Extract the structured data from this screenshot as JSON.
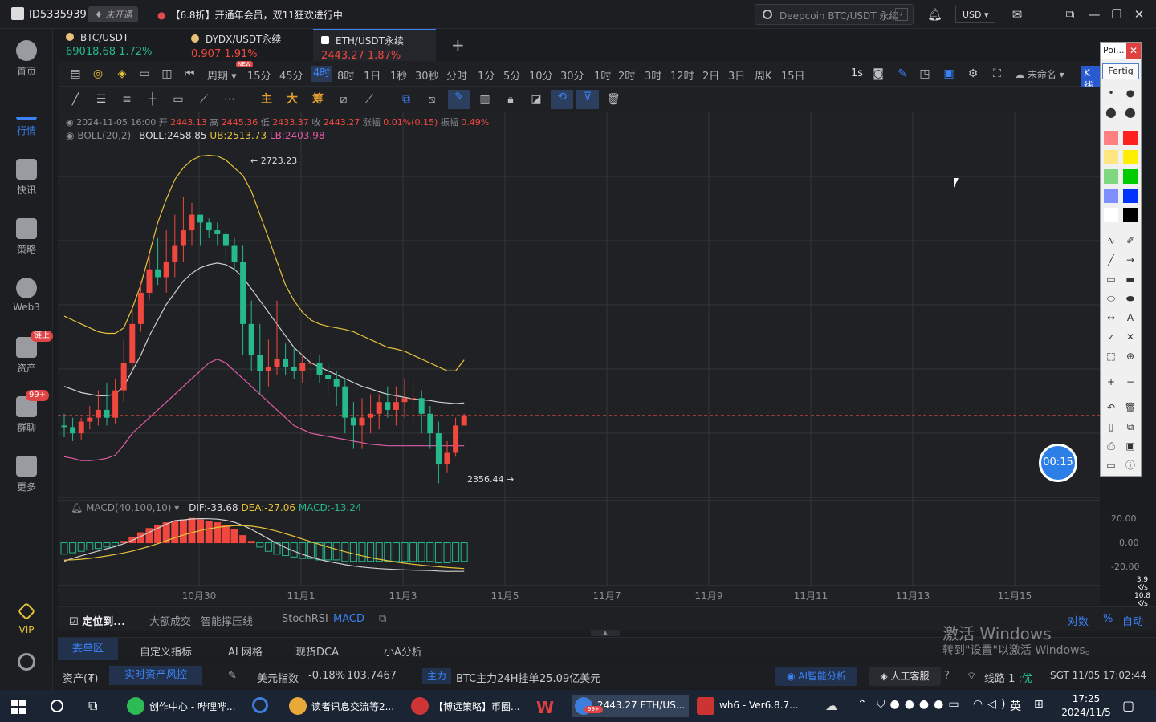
{
  "topbar": {
    "user_id": "ID5335939",
    "vip_status": "未开通",
    "promo": "【6.8折】开通年会员，双11狂欢进行中",
    "search_placeholder": "Deepcoin BTC/USDT 永续",
    "search_shortcut": "/",
    "currency": "USD"
  },
  "sidebar": {
    "items": [
      {
        "label": "首页"
      },
      {
        "label": "行情"
      },
      {
        "label": "快讯"
      },
      {
        "label": "策略"
      },
      {
        "label": "Web3"
      },
      {
        "label": "资产",
        "badge": "链上"
      },
      {
        "label": "群聊",
        "badge": "99+"
      },
      {
        "label": "更多"
      },
      {
        "label": "VIP"
      }
    ]
  },
  "tabs": [
    {
      "symbol": "BTC/USDT",
      "price": "69018.68",
      "change": "1.72%",
      "color": "#26b98c"
    },
    {
      "symbol": "DYDX/USDT永续",
      "price": "0.907",
      "change": "1.91%",
      "color": "#f0483e"
    },
    {
      "symbol": "ETH/USDT永续",
      "price": "2443.27",
      "change": "1.87%",
      "color": "#f0483e"
    }
  ],
  "timeframes": {
    "period_label": "周期",
    "new_badge": "NEW",
    "items": [
      "15分",
      "45分",
      "4时",
      "8时",
      "1日",
      "1秒",
      "30秒",
      "分时",
      "1分",
      "5分",
      "10分",
      "30分",
      "1时",
      "2时",
      "3时",
      "12时",
      "2日",
      "3日",
      "周K",
      "15日"
    ],
    "active": "4时",
    "right_interval": "1s",
    "layout_name": "未命名",
    "kline_label": "K线"
  },
  "tools": {
    "labels": [
      "主",
      "大",
      "筹"
    ]
  },
  "chart_info": {
    "date": "2024-11-05 16:00",
    "open_label": "开",
    "open": "2443.13",
    "high_label": "高",
    "high": "2445.36",
    "low_label": "低",
    "low": "2433.37",
    "close_label": "收",
    "close": "2443.27",
    "change_label": "涨幅",
    "change": "0.01%(0.15)",
    "amp_label": "振幅",
    "amp": "0.49%",
    "boll_name": "BOLL(20,2)",
    "boll": "BOLL:2458.85",
    "ub": "UB:2513.73",
    "lb": "LB:2403.98",
    "high_marker": "2723.23",
    "low_marker": "2356.44",
    "macd_name": "MACD(40,100,10)",
    "dif": "DIF:-33.68",
    "dea": "DEA:-27.06",
    "macd": "MACD:-13.24",
    "timer": "00:15",
    "macd_axis": [
      "20.00",
      "0.00",
      "-20.00"
    ],
    "speed_up": "3.9",
    "speed_up_unit": "K/s",
    "speed_down": "10.8",
    "speed_down_unit": "K/s",
    "x_labels": [
      "10月30",
      "11月1",
      "11月3",
      "11月5",
      "11月7",
      "11月9",
      "11月11",
      "11月13",
      "11月15",
      "11月"
    ]
  },
  "chart_data": {
    "type": "candlestick",
    "x": [
      "10月28 20:00",
      "10月29 00:00",
      "10月29 04:00",
      "10月29 08:00",
      "10月29 12:00",
      "10月29 16:00",
      "10月29 20:00",
      "10月30 00:00",
      "10月30 04:00",
      "10月30 08:00",
      "10月30 12:00",
      "10月30 16:00",
      "10月30 20:00",
      "10月31 00:00",
      "10月31 04:00",
      "10月31 08:00",
      "10月31 12:00",
      "10月31 16:00",
      "10月31 20:00",
      "11月1 00:00",
      "11月1 04:00",
      "11月1 08:00",
      "11月1 12:00",
      "11月1 16:00",
      "11月1 20:00",
      "11月2 00:00",
      "11月2 04:00",
      "11月2 08:00",
      "11月2 12:00",
      "11月2 16:00",
      "11月2 20:00",
      "11月3 00:00",
      "11月3 04:00",
      "11月3 08:00",
      "11月3 12:00",
      "11月3 16:00",
      "11月3 20:00",
      "11月4 00:00",
      "11月4 04:00",
      "11月4 08:00",
      "11月4 12:00",
      "11月4 16:00",
      "11月4 20:00",
      "11月5 00:00",
      "11月5 04:00",
      "11月5 08:00",
      "11月5 12:00",
      "11月5 16:00"
    ],
    "open": [
      2430,
      2428,
      2420,
      2435,
      2440,
      2450,
      2440,
      2475,
      2510,
      2560,
      2600,
      2630,
      2620,
      2640,
      2660,
      2680,
      2700,
      2690,
      2680,
      2675,
      2660,
      2640,
      2560,
      2520,
      2500,
      2505,
      2515,
      2505,
      2500,
      2510,
      2510,
      2495,
      2490,
      2480,
      2440,
      2430,
      2440,
      2445,
      2460,
      2450,
      2460,
      2465,
      2465,
      2445,
      2420,
      2380,
      2395,
      2430
    ],
    "high": [
      2445,
      2440,
      2440,
      2455,
      2475,
      2485,
      2490,
      2540,
      2580,
      2615,
      2650,
      2670,
      2680,
      2700,
      2723,
      2715,
      2700,
      2695,
      2690,
      2680,
      2670,
      2660,
      2590,
      2560,
      2540,
      2590,
      2535,
      2530,
      2520,
      2525,
      2520,
      2510,
      2500,
      2490,
      2460,
      2465,
      2470,
      2470,
      2480,
      2480,
      2490,
      2490,
      2475,
      2455,
      2435,
      2410,
      2440,
      2445
    ],
    "low": [
      2415,
      2410,
      2412,
      2425,
      2430,
      2430,
      2432,
      2460,
      2500,
      2550,
      2590,
      2610,
      2600,
      2620,
      2640,
      2660,
      2660,
      2670,
      2660,
      2640,
      2630,
      2520,
      2500,
      2470,
      2480,
      2495,
      2495,
      2490,
      2485,
      2490,
      2485,
      2470,
      2455,
      2420,
      2400,
      2400,
      2420,
      2425,
      2440,
      2430,
      2440,
      2430,
      2420,
      2400,
      2356,
      2370,
      2390,
      2433
    ],
    "close": [
      2428,
      2420,
      2435,
      2440,
      2450,
      2440,
      2475,
      2510,
      2560,
      2600,
      2630,
      2620,
      2640,
      2660,
      2680,
      2700,
      2690,
      2680,
      2675,
      2660,
      2640,
      2560,
      2520,
      2500,
      2505,
      2515,
      2505,
      2500,
      2510,
      2510,
      2495,
      2490,
      2480,
      2440,
      2430,
      2440,
      2445,
      2460,
      2450,
      2460,
      2465,
      2465,
      2445,
      2420,
      2380,
      2395,
      2430,
      2443
    ],
    "boll_ub": [
      2570,
      2565,
      2560,
      2555,
      2550,
      2548,
      2548,
      2555,
      2580,
      2610,
      2650,
      2690,
      2720,
      2745,
      2760,
      2770,
      2775,
      2776,
      2775,
      2770,
      2760,
      2750,
      2730,
      2700,
      2670,
      2640,
      2610,
      2590,
      2575,
      2565,
      2560,
      2557,
      2555,
      2553,
      2550,
      2545,
      2540,
      2535,
      2530,
      2528,
      2525,
      2520,
      2515,
      2510,
      2505,
      2500,
      2500,
      2514
    ],
    "boll_mid": [
      2480,
      2476,
      2472,
      2470,
      2468,
      2468,
      2470,
      2480,
      2500,
      2520,
      2545,
      2565,
      2585,
      2600,
      2615,
      2625,
      2632,
      2636,
      2638,
      2636,
      2630,
      2620,
      2605,
      2590,
      2575,
      2560,
      2545,
      2530,
      2520,
      2510,
      2505,
      2500,
      2495,
      2490,
      2485,
      2480,
      2477,
      2473,
      2470,
      2468,
      2466,
      2464,
      2463,
      2462,
      2460,
      2459,
      2458,
      2459
    ],
    "boll_lb": [
      2390,
      2388,
      2385,
      2385,
      2386,
      2388,
      2392,
      2405,
      2420,
      2430,
      2440,
      2450,
      2460,
      2470,
      2480,
      2490,
      2500,
      2510,
      2515,
      2510,
      2500,
      2490,
      2480,
      2470,
      2460,
      2450,
      2440,
      2430,
      2425,
      2420,
      2418,
      2416,
      2414,
      2412,
      2410,
      2408,
      2406,
      2405,
      2404,
      2404,
      2404,
      2404,
      2404,
      2404,
      2404,
      2404,
      2404,
      2404
    ],
    "macd_hist": [
      -8,
      -7,
      -6,
      -5,
      -4,
      -3,
      -2,
      1,
      4,
      7,
      10,
      12,
      14,
      15,
      16,
      17,
      16,
      15,
      14,
      12,
      9,
      5,
      1,
      -3,
      -6,
      -8,
      -9,
      -10,
      -11,
      -11,
      -12,
      -12,
      -12,
      -13,
      -13,
      -13,
      -13,
      -13,
      -13,
      -13,
      -13,
      -13,
      -13,
      -13,
      -14,
      -14,
      -13,
      -13
    ],
    "ylim": [
      2340,
      2790
    ],
    "macd_ylim": [
      -30,
      25
    ]
  },
  "indicators": {
    "locate": "定位到...",
    "items": [
      "大额成交",
      "智能撑压线",
      "StochRSI",
      "MACD"
    ],
    "right": [
      "对数",
      "%",
      "自动"
    ]
  },
  "subtabs": [
    "委单区",
    "自定义指标",
    "AI 网格",
    "现货DCA",
    "小A分析"
  ],
  "status": {
    "assets": "资产(₮)",
    "risk": "实时资产风控",
    "usd_index_label": "美元指数",
    "usd_change": "-0.18%",
    "usd_value": "103.7467",
    "main_tag": "主力",
    "btc_label": "BTC主力24H挂单",
    "btc_value": "25.09亿美元",
    "ai_label": "AI智能分析",
    "service": "人工客服",
    "line": "线路 1 :",
    "line_quality": "优",
    "time": "SGT 11/05 17:02:44"
  },
  "paint": {
    "title": "Poi...",
    "done": "Fertig",
    "colors": [
      "#ff8080",
      "#ff2020",
      "#ffe680",
      "#ffee00",
      "#7fd87f",
      "#00cc00",
      "#8090ff",
      "#0033ff",
      "#ffffff",
      "#000000"
    ]
  },
  "activate_windows": {
    "line1": "激活 Windows",
    "line2": "转到\"设置\"以激活 Windows。"
  },
  "taskbar": {
    "apps": [
      {
        "label": "创作中心 - 哔哩哔...",
        "color": "#2dbb55"
      },
      {
        "label": "读者讯息交流等2...",
        "color": "#e8a83a"
      },
      {
        "label": "【博远策略】币圈...",
        "color": "#d03535"
      },
      {
        "label": "2443.27 ETH/US...",
        "color": "#3d7ddc",
        "badge": "99+"
      },
      {
        "label": "wh6  -  Ver6.8.7...",
        "color": "#c33"
      }
    ],
    "ime": "英",
    "clock_time": "17:25",
    "clock_date": "2024/11/5"
  }
}
